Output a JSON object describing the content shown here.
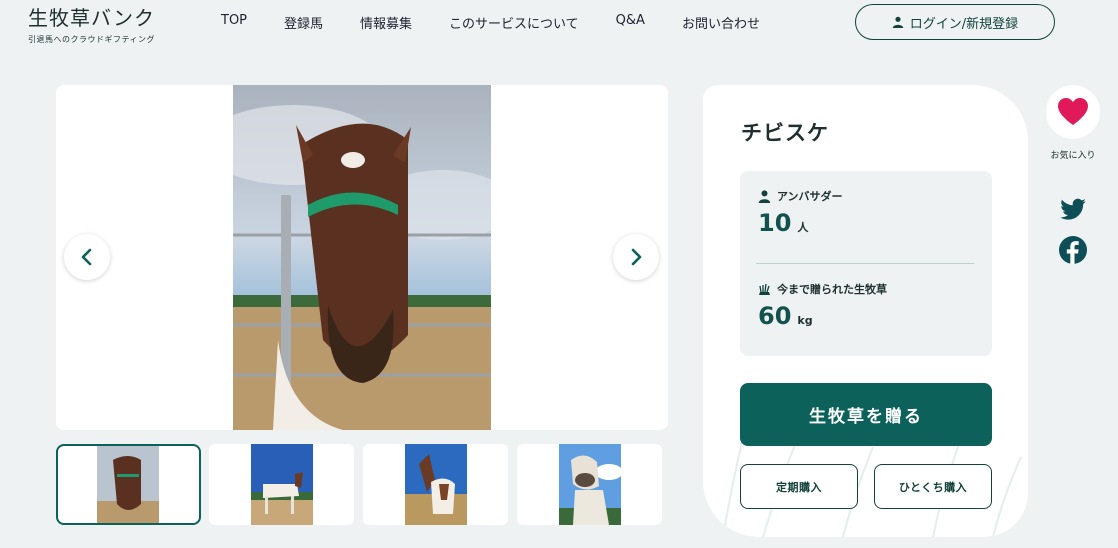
{
  "header": {
    "logo_title": "生牧草バンク",
    "logo_subtitle": "引退馬へのクラウドギフティング",
    "nav": [
      "TOP",
      "登録馬",
      "情報募集",
      "このサービスについて",
      "Q&A",
      "お問い合わせ"
    ],
    "login_label": "ログイン/新規登録"
  },
  "horse": {
    "name": "チビスケ",
    "ambassador_label": "アンバサダー",
    "ambassador_count": "10",
    "ambassador_unit": "人",
    "gifted_label": "今まで贈られた生牧草",
    "gifted_amount": "60",
    "gifted_unit": "kg"
  },
  "actions": {
    "gift_label": "生牧草を贈る",
    "subscription_label": "定期購入",
    "single_label": "ひとくち購入"
  },
  "side": {
    "favorite_label": "お気に入り"
  },
  "colors": {
    "brand": "#0c625a",
    "background": "#eef2f2",
    "heart": "#e0195a",
    "social": "#0e4f57"
  },
  "icons": [
    "user-icon",
    "chevron-left-icon",
    "chevron-right-icon",
    "person-icon",
    "grass-icon",
    "heart-icon",
    "twitter-icon",
    "facebook-icon"
  ]
}
